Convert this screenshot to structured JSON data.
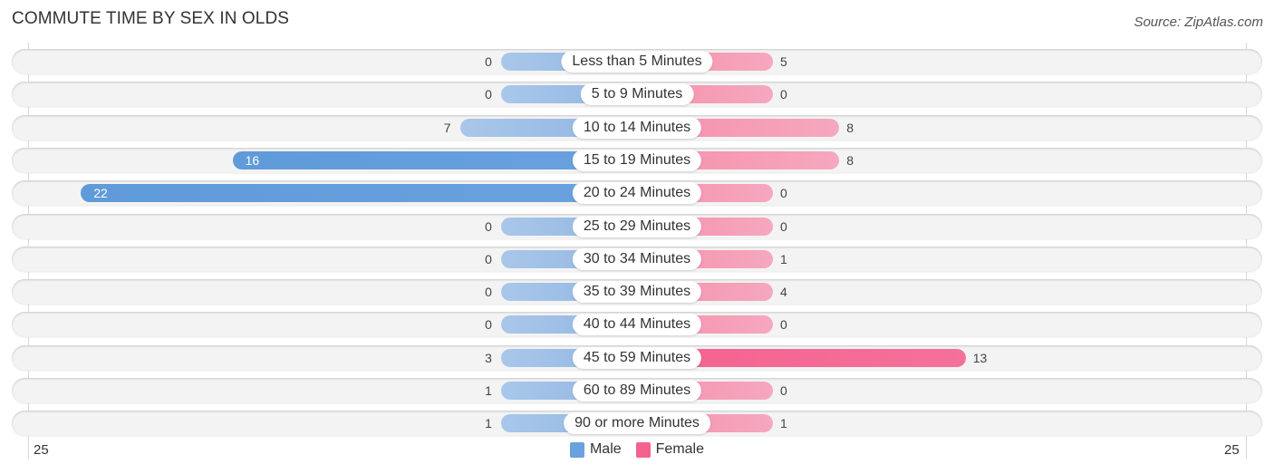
{
  "header": {
    "title": "COMMUTE TIME BY SEX IN OLDS",
    "source": "Source: ZipAtlas.com"
  },
  "colors": {
    "male": "#6aa2de",
    "male_light": "#a9c7ea",
    "female": "#f4628e",
    "female_light": "#f5a8bf"
  },
  "chart_data": {
    "type": "bar",
    "orientation": "horizontal-diverging",
    "title": "COMMUTE TIME BY SEX IN OLDS",
    "xlim": [
      -25,
      25
    ],
    "axis_tick_labels": {
      "left": "25",
      "right": "25"
    },
    "legend": {
      "position": "bottom-center",
      "entries": [
        "Male",
        "Female"
      ]
    },
    "categories": [
      "Less than 5 Minutes",
      "5 to 9 Minutes",
      "10 to 14 Minutes",
      "15 to 19 Minutes",
      "20 to 24 Minutes",
      "25 to 29 Minutes",
      "30 to 34 Minutes",
      "35 to 39 Minutes",
      "40 to 44 Minutes",
      "45 to 59 Minutes",
      "60 to 89 Minutes",
      "90 or more Minutes"
    ],
    "series": [
      {
        "name": "Male",
        "values": [
          0,
          0,
          7,
          16,
          22,
          0,
          0,
          0,
          0,
          3,
          1,
          1
        ]
      },
      {
        "name": "Female",
        "values": [
          5,
          0,
          8,
          8,
          0,
          0,
          1,
          4,
          0,
          13,
          0,
          1
        ]
      }
    ]
  }
}
